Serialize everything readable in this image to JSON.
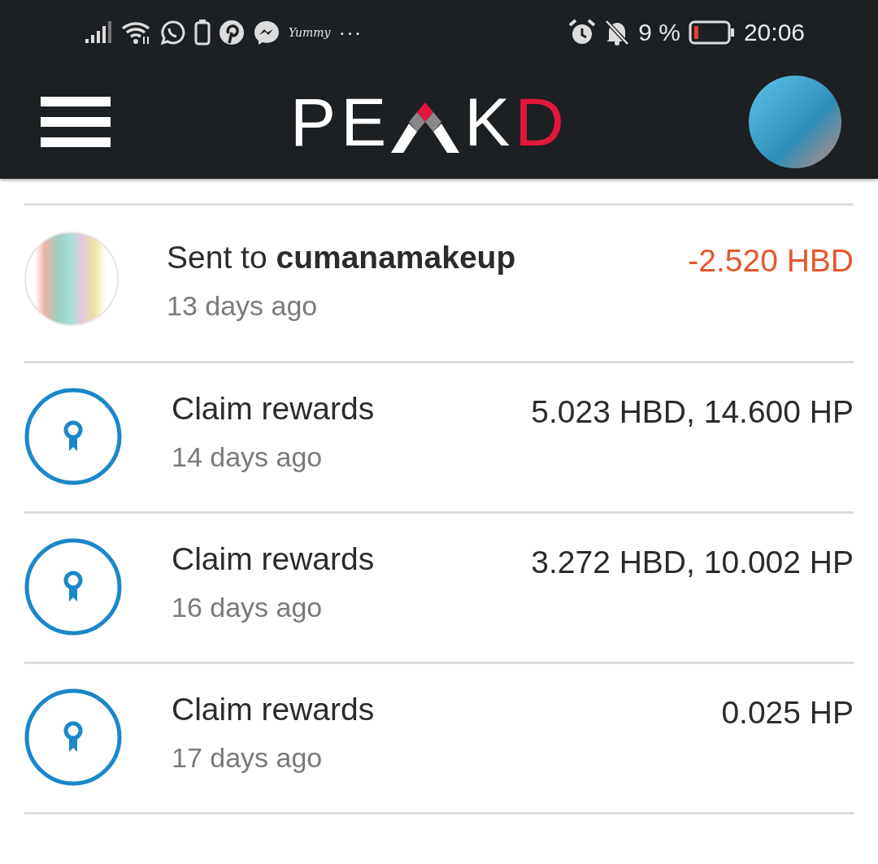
{
  "status_bar": {
    "app_label": "Yummy",
    "more": "···",
    "battery_percent": "9 %",
    "time": "20:06"
  },
  "header": {
    "logo": {
      "before": "PE",
      "after": "K",
      "accent": "D"
    }
  },
  "transactions": [
    {
      "kind": "transfer",
      "title": "Sent to **cumanamakeup**",
      "time": "13 days ago",
      "amount": "-2.520 HBD",
      "negative": true
    },
    {
      "kind": "claim",
      "title": "Claim rewards",
      "time": "14 days ago",
      "amount": "5.023 HBD, 14.600 HP",
      "negative": false
    },
    {
      "kind": "claim",
      "title": "Claim rewards",
      "time": "16 days ago",
      "amount": "3.272 HBD, 10.002 HP",
      "negative": false
    },
    {
      "kind": "claim",
      "title": "Claim rewards",
      "time": "17 days ago",
      "amount": "0.025 HP",
      "negative": false
    }
  ]
}
